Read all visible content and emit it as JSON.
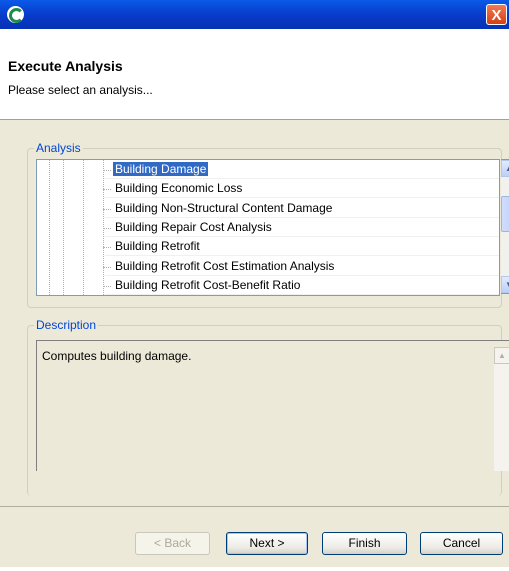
{
  "header": {
    "title": "Execute Analysis",
    "subtitle": "Please select an analysis..."
  },
  "analysis": {
    "label": "Analysis",
    "items": [
      {
        "label": "Building Damage",
        "selected": true
      },
      {
        "label": "Building Economic Loss"
      },
      {
        "label": "Building Non-Structural Content Damage"
      },
      {
        "label": "Building Repair Cost Analysis"
      },
      {
        "label": "Building Retrofit"
      },
      {
        "label": "Building Retrofit Cost Estimation Analysis"
      },
      {
        "label": "Building Retrofit Cost-Benefit Ratio"
      }
    ]
  },
  "description": {
    "label": "Description",
    "text": "Computes building damage."
  },
  "buttons": {
    "back": "< Back",
    "next": "Next >",
    "finish": "Finish",
    "cancel": "Cancel"
  },
  "titlebar": {
    "close_label": "X"
  },
  "colors": {
    "title_bar": "#0a5ae8",
    "selection": "#316ac5",
    "group_label": "#0046d5"
  }
}
